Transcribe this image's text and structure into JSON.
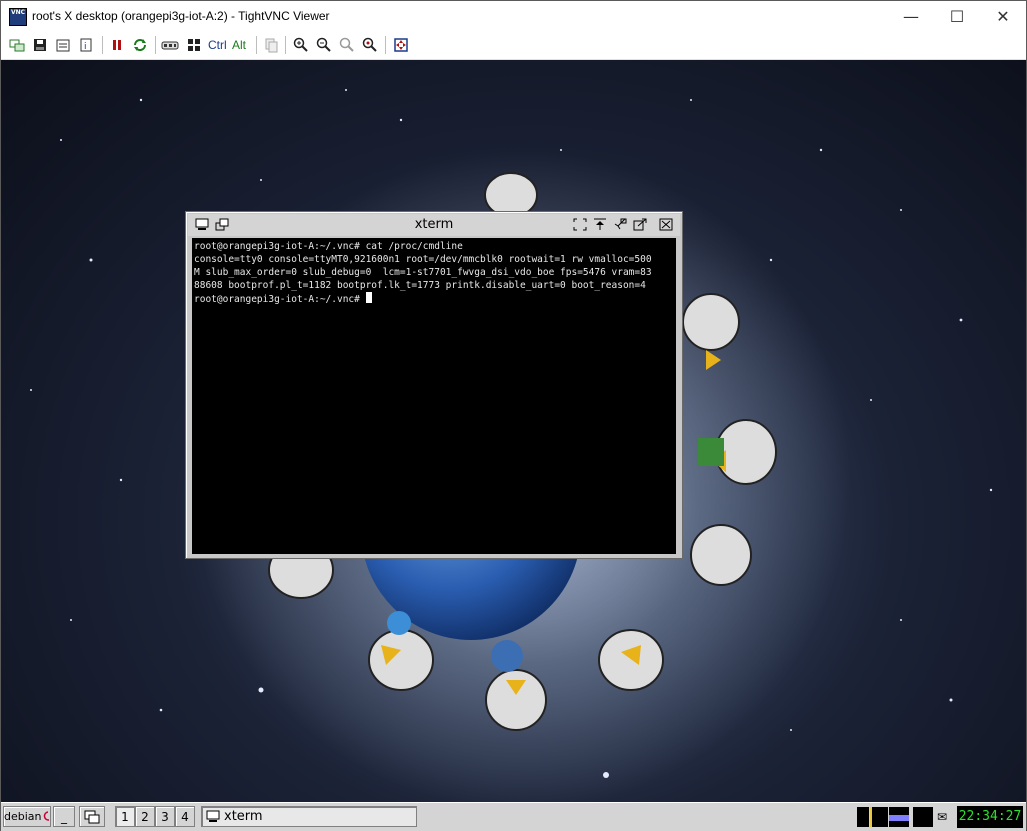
{
  "window": {
    "title": "root's X desktop (orangepi3g-iot-A:2) - TightVNC Viewer",
    "app_icon_text": "VNC",
    "controls": {
      "minimize": "—",
      "maximize": "☐",
      "close": "✕"
    }
  },
  "toolbar": {
    "ctrl_label": "Ctrl",
    "alt_label": "Alt"
  },
  "xterm": {
    "title": "xterm",
    "lines": [
      "root@orangepi3g-iot-A:~/.vnc# cat /proc/cmdline",
      "console=tty0 console=ttyMT0,921600n1 root=/dev/mmcblk0 rootwait=1 rw vmalloc=500",
      "M slub_max_order=0 slub_debug=0  lcm=1-st7701_fwvga_dsi_vdo_boe fps=5476 vram=83",
      "88608 bootprof.pl_t=1182 bootprof.lk_t=1773 printk.disable_uart=0 boot_reason=4"
    ],
    "prompt": "root@orangepi3g-iot-A:~/.vnc# "
  },
  "taskbar": {
    "start_label": "debian",
    "minimize_label": "_",
    "workspaces": [
      "1",
      "2",
      "3",
      "4"
    ],
    "task_label": "xterm",
    "clock": "22:34:27"
  }
}
